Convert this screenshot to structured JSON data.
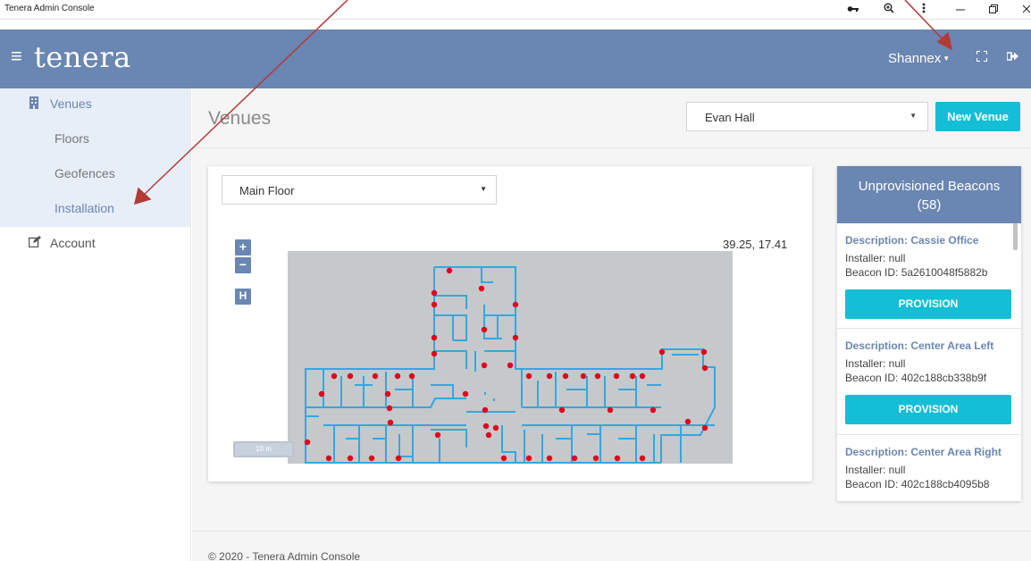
{
  "window": {
    "title": "Tenera Admin Console",
    "icons": [
      "key-icon",
      "zoom-icon",
      "more-icon",
      "minimize-icon",
      "restore-icon",
      "close-icon"
    ]
  },
  "header": {
    "brand": "tenera",
    "user": "Shannex",
    "icons": [
      "menu-icon",
      "fullscreen-icon",
      "logout-icon"
    ],
    "color": "#6a86b2"
  },
  "sidebar": {
    "items": [
      {
        "label": "Venues",
        "icon": "building-icon"
      },
      {
        "label": "Floors"
      },
      {
        "label": "Geofences"
      },
      {
        "label": "Installation"
      },
      {
        "label": "Account",
        "icon": "edit-icon"
      }
    ]
  },
  "main": {
    "title": "Venues",
    "venue_select": "Evan Hall",
    "new_venue_label": "New Venue",
    "floor_select": "Main Floor",
    "zoom_in": "+",
    "zoom_out": "−",
    "home": "H",
    "coords": "39.25, 17.41",
    "scale_label": "10 m"
  },
  "beacons": {
    "title": "Unprovisioned Beacons",
    "count": "(58)",
    "items": [
      {
        "description": "Description: Cassie Office",
        "installer": "Installer: null",
        "beacon_id": "Beacon ID: 5a2610048f5882b",
        "button": "PROVISION"
      },
      {
        "description": "Description: Center Area Left",
        "installer": "Installer: null",
        "beacon_id": "Beacon ID: 402c188cb338b9f",
        "button": "PROVISION"
      },
      {
        "description": "Description: Center Area Right",
        "installer": "Installer: null",
        "beacon_id": "Beacon ID: 402c188cb4095b8"
      }
    ]
  },
  "footer": "© 2020 - Tenera Admin Console",
  "colors": {
    "accent": "#13bed6",
    "header": "#6a86b2",
    "beacon_dot": "#e3001b",
    "wall": "#34a7df",
    "annotation": "#b23b38"
  }
}
